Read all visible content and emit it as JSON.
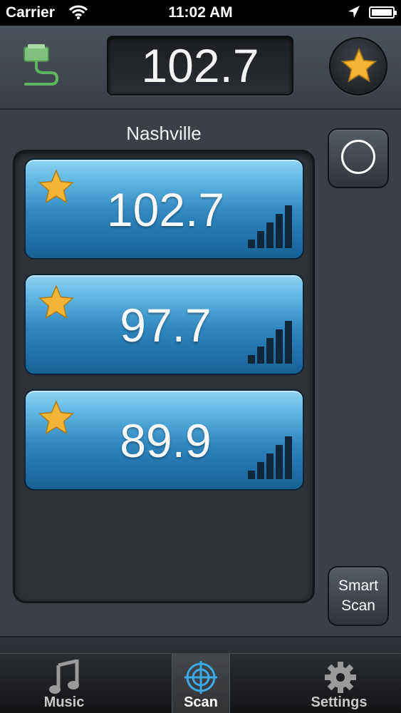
{
  "status_bar": {
    "carrier": "Carrier",
    "time": "11:02 AM"
  },
  "header": {
    "current_frequency": "102.7",
    "plug_icon": "cable-plug-icon",
    "favorite_icon": "star-icon"
  },
  "main": {
    "city": "Nashville",
    "stations": [
      {
        "frequency": "102.7",
        "favorite": true,
        "signal_bars": 5
      },
      {
        "frequency": "97.7",
        "favorite": true,
        "signal_bars": 5
      },
      {
        "frequency": "89.9",
        "favorite": true,
        "signal_bars": 5
      }
    ],
    "record_icon": "record-circle-icon",
    "smart_scan_label": "Smart\nScan"
  },
  "tabs": [
    {
      "label": "Music",
      "icon": "music-note-icon",
      "active": false
    },
    {
      "label": "Scan",
      "icon": "scan-crosshair-icon",
      "active": true
    },
    {
      "label": "Settings",
      "icon": "gear-icon",
      "active": false
    }
  ],
  "colors": {
    "card_top": "#8fd4f3",
    "card_bottom": "#166195",
    "star": "#f2b535",
    "background": "#3b4047"
  }
}
